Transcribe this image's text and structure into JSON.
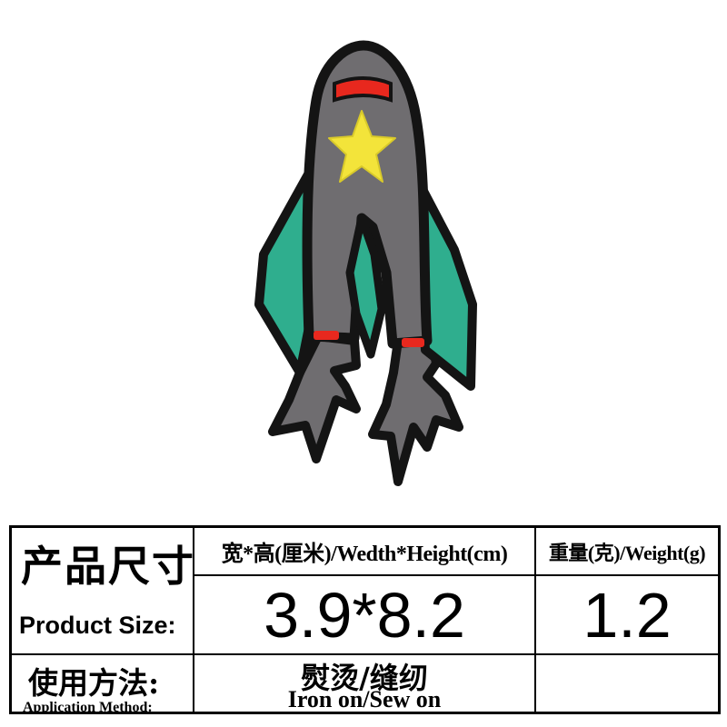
{
  "product_image": {
    "subject": "rocket-embroidered-patch",
    "colors": {
      "body": "#6f6d70",
      "outline": "#141414",
      "fin": "#2fae8e",
      "band": "#e8281e",
      "star": "#f3e43a"
    }
  },
  "spec_table": {
    "size_label_cn": "产品尺寸",
    "size_label_en": "Product Size:",
    "dimension_header": "宽*高(厘米)/Wedth*Height(cm)",
    "weight_header": "重量(克)/Weight(g)",
    "dimension_value": "3.9*8.2",
    "weight_value": "1.2",
    "method_label_cn": "使用方法:",
    "method_label_en": "Application Method:",
    "method_value_cn": "熨烫/缝纫",
    "method_value_en": "Iron on/Sew on"
  }
}
